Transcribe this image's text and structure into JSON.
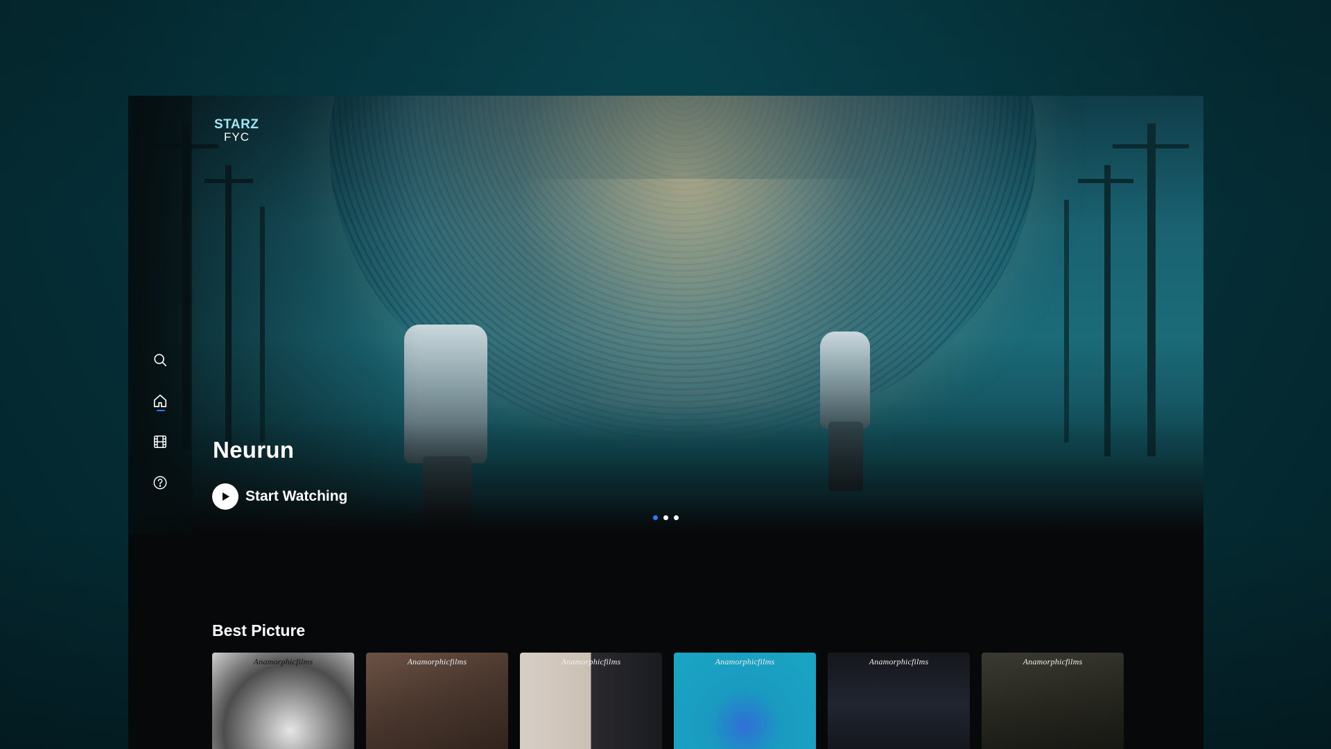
{
  "brand": {
    "line1": "STARZ",
    "line2": "FYC"
  },
  "nav": {
    "items": [
      {
        "name": "search",
        "icon": "search-icon"
      },
      {
        "name": "home",
        "icon": "home-icon",
        "active": true
      },
      {
        "name": "movies",
        "icon": "film-icon"
      },
      {
        "name": "help",
        "icon": "help-icon"
      }
    ]
  },
  "hero": {
    "title": "Neurun",
    "cta_label": "Start Watching",
    "carousel": {
      "count": 3,
      "active_index": 0
    }
  },
  "sections": [
    {
      "title": "Best Picture",
      "cards": [
        {
          "brand": "Anamorphicfilms"
        },
        {
          "brand": "Anamorphicfilms"
        },
        {
          "brand": "Anamorphicfilms"
        },
        {
          "brand": "Anamorphicfilms"
        },
        {
          "brand": "Anamorphicfilms"
        },
        {
          "brand": "Anamorphicfilms"
        }
      ]
    }
  ],
  "colors": {
    "accent": "#2a7bff",
    "logo": "#9ee7f4",
    "background": "#070809"
  }
}
